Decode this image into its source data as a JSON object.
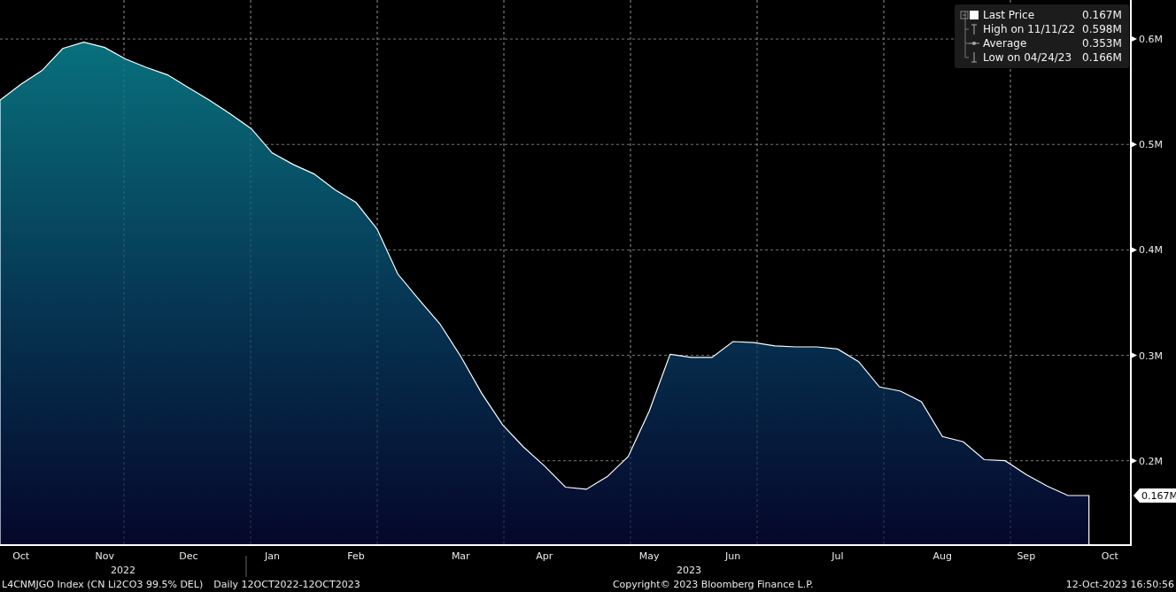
{
  "chart": {
    "chart_data": {
      "type": "area",
      "categories": [
        null,
        "Oct",
        null,
        null,
        null,
        "Nov",
        null,
        null,
        null,
        "Dec",
        null,
        null,
        null,
        "Jan",
        null,
        null,
        null,
        "Feb",
        null,
        null,
        null,
        null,
        "Mar",
        null,
        null,
        null,
        "Apr",
        null,
        null,
        null,
        null,
        "May",
        null,
        null,
        null,
        "Jun",
        null,
        null,
        null,
        null,
        "Jul",
        null,
        null,
        null,
        null,
        "Aug",
        null,
        null,
        null,
        "Sep",
        null,
        null,
        null,
        "Oct"
      ],
      "series": [
        {
          "name": "Last Price",
          "color": "#ffffff",
          "values": [
            0.542,
            0.557,
            0.57,
            0.591,
            0.597,
            0.592,
            0.581,
            0.573,
            0.566,
            0.554,
            0.542,
            0.529,
            0.515,
            0.492,
            0.481,
            0.472,
            0.457,
            0.445,
            0.42,
            0.377,
            0.353,
            0.33,
            0.299,
            0.264,
            0.234,
            0.213,
            0.195,
            0.175,
            0.173,
            0.185,
            0.204,
            0.247,
            0.301,
            0.298,
            0.298,
            0.313,
            0.312,
            0.309,
            0.308,
            0.308,
            0.306,
            0.294,
            0.27,
            0.266,
            0.256,
            0.223,
            0.218,
            0.201,
            0.2,
            0.187,
            0.176,
            0.167,
            0.167,
            null
          ]
        }
      ],
      "ylim": [
        0.12,
        0.637
      ],
      "grid": true,
      "yticks": [
        {
          "value": 0.2,
          "label": "0.2M"
        },
        {
          "value": 0.3,
          "label": "0.3M"
        },
        {
          "value": 0.4,
          "label": "0.4M"
        },
        {
          "value": 0.5,
          "label": "0.5M"
        },
        {
          "value": 0.6,
          "label": "0.6M"
        }
      ]
    },
    "year_labels": [
      "2022",
      "2023"
    ],
    "last_price_tag": "0.167M"
  },
  "legend": {
    "items": [
      {
        "kind": "last",
        "value": "0.167M"
      },
      {
        "kind": "high",
        "label": "High on 11/11/22",
        "value": "0.598M"
      },
      {
        "kind": "average",
        "label": "Average",
        "value": "0.353M"
      },
      {
        "kind": "low",
        "label": "Low on 04/24/23",
        "value": "0.166M"
      }
    ]
  },
  "footer": {
    "ticker": "L4CNMJGO Index (CN Li2CO3 99.5% DEL)",
    "range": "Daily 12OCT2022-12OCT2023",
    "copyright": "Copyright© 2023 Bloomberg Finance L.P.",
    "timestamp": "12-Oct-2023 16:50:56"
  }
}
